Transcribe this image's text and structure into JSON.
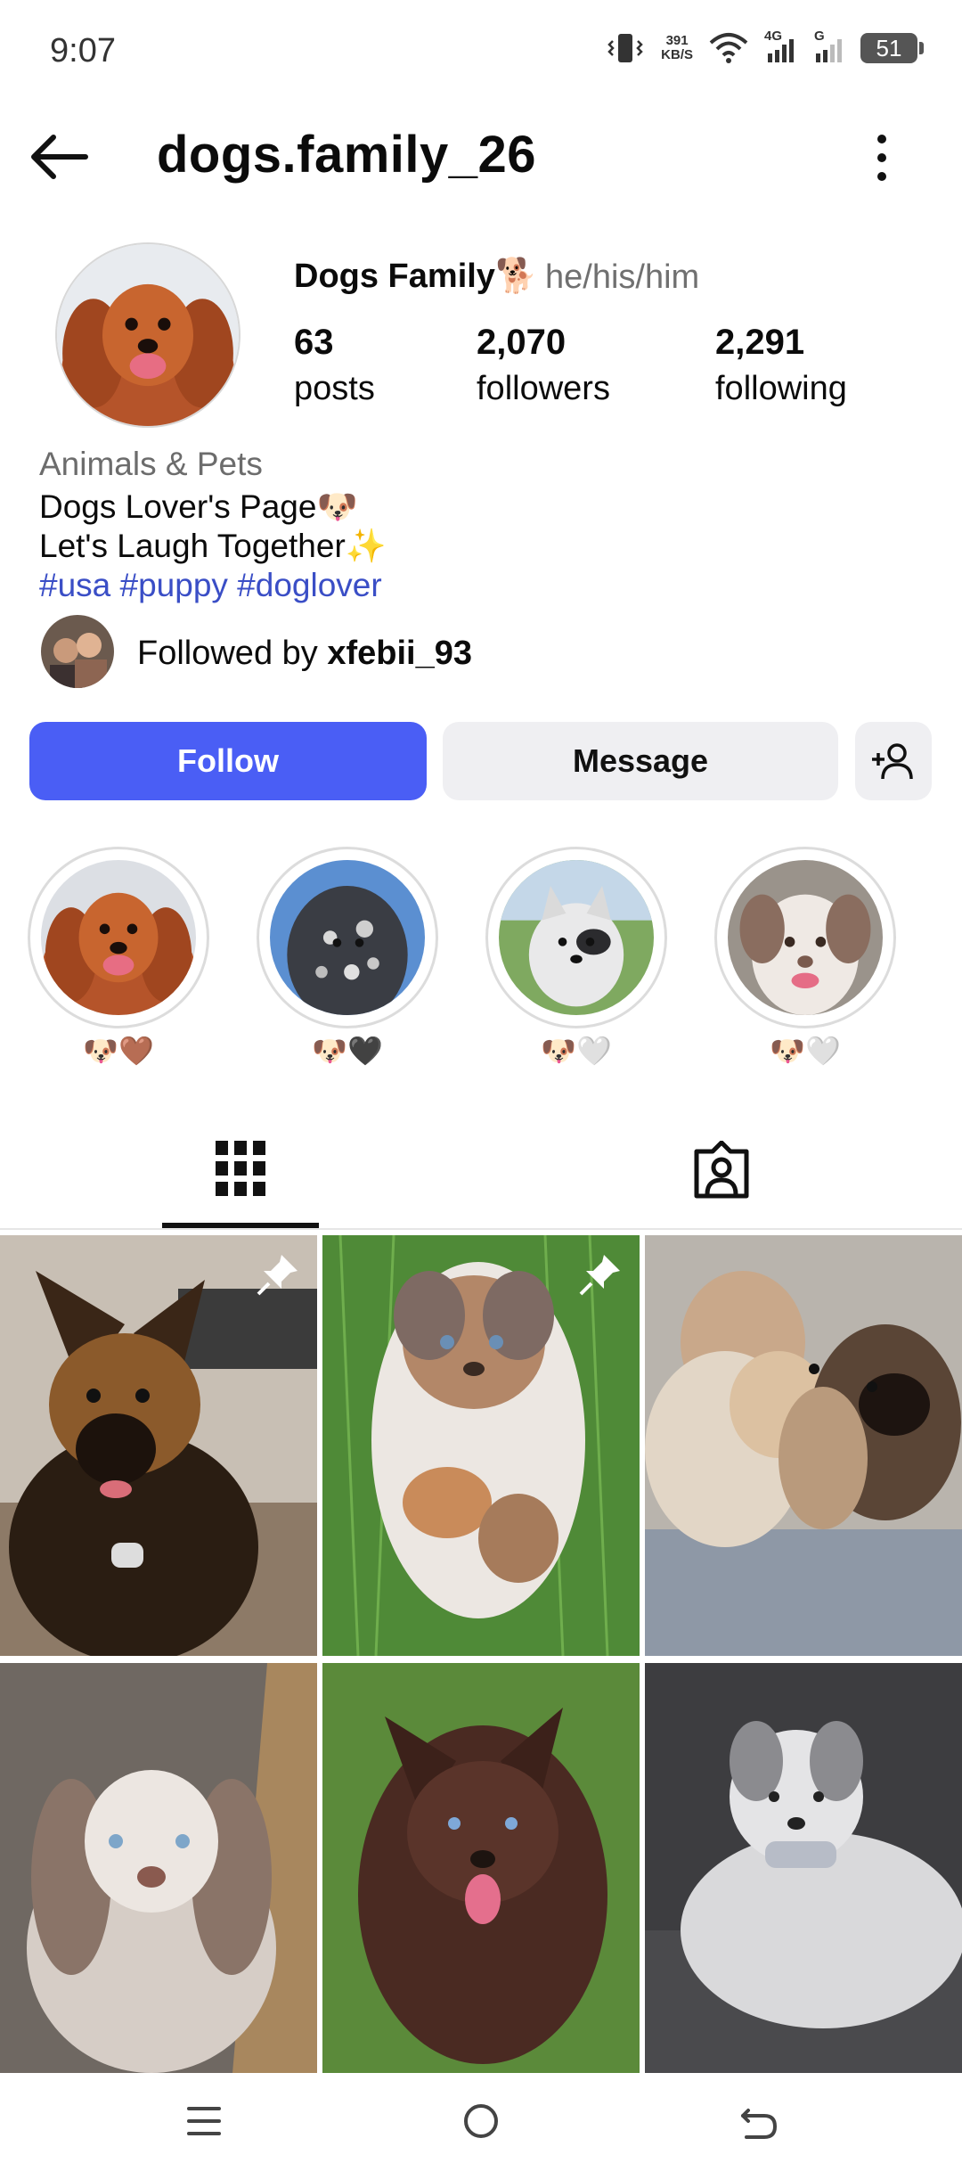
{
  "status_bar": {
    "time": "9:07",
    "net_speed_value": "391",
    "net_speed_unit": "KB/S",
    "signal1_label": "4G",
    "signal2_label": "G",
    "battery": "51",
    "icons": [
      "vibrate-icon",
      "wifi-icon",
      "signal-icon",
      "battery-icon"
    ]
  },
  "header": {
    "username": "dogs.family_26",
    "icons": [
      "back-arrow-icon",
      "more-vertical-icon"
    ]
  },
  "profile": {
    "display_name": "Dogs Family🐕",
    "pronouns": "he/his/him",
    "stats": [
      {
        "value": "63",
        "label": "posts"
      },
      {
        "value": "2,070",
        "label": "followers"
      },
      {
        "value": "2,291",
        "label": "following"
      }
    ],
    "category": "Animals & Pets",
    "bio_line1": "Dogs Lover's Page🐶",
    "bio_line2": "Let's Laugh Together✨",
    "hashtags": "#usa #puppy #doglover",
    "followed_prefix": "Followed by ",
    "followed_user": "xfebii_93"
  },
  "actions": {
    "follow_label": "Follow",
    "message_label": "Message",
    "add_icon": "add-person-icon"
  },
  "highlights": [
    {
      "label": "🐶🤎"
    },
    {
      "label": "🐶🖤"
    },
    {
      "label": "🐶🤍"
    },
    {
      "label": "🐶🤍"
    }
  ],
  "tabs": [
    {
      "name": "posts-grid-tab",
      "icon": "grid-icon",
      "active": true
    },
    {
      "name": "tagged-tab",
      "icon": "tagged-person-icon",
      "active": false
    }
  ],
  "grid_posts": [
    {
      "pinned": true
    },
    {
      "pinned": true
    },
    {
      "pinned": false
    },
    {
      "pinned": false
    },
    {
      "pinned": false
    },
    {
      "pinned": false
    }
  ],
  "nav_bar": {
    "icons": [
      "menu-icon",
      "home-circle-icon",
      "back-nav-icon"
    ]
  },
  "colors": {
    "accent": "#4a5ef5",
    "hashtag": "#3a4ec6",
    "secondary_text": "#707070",
    "button_gray": "#efeff2"
  }
}
